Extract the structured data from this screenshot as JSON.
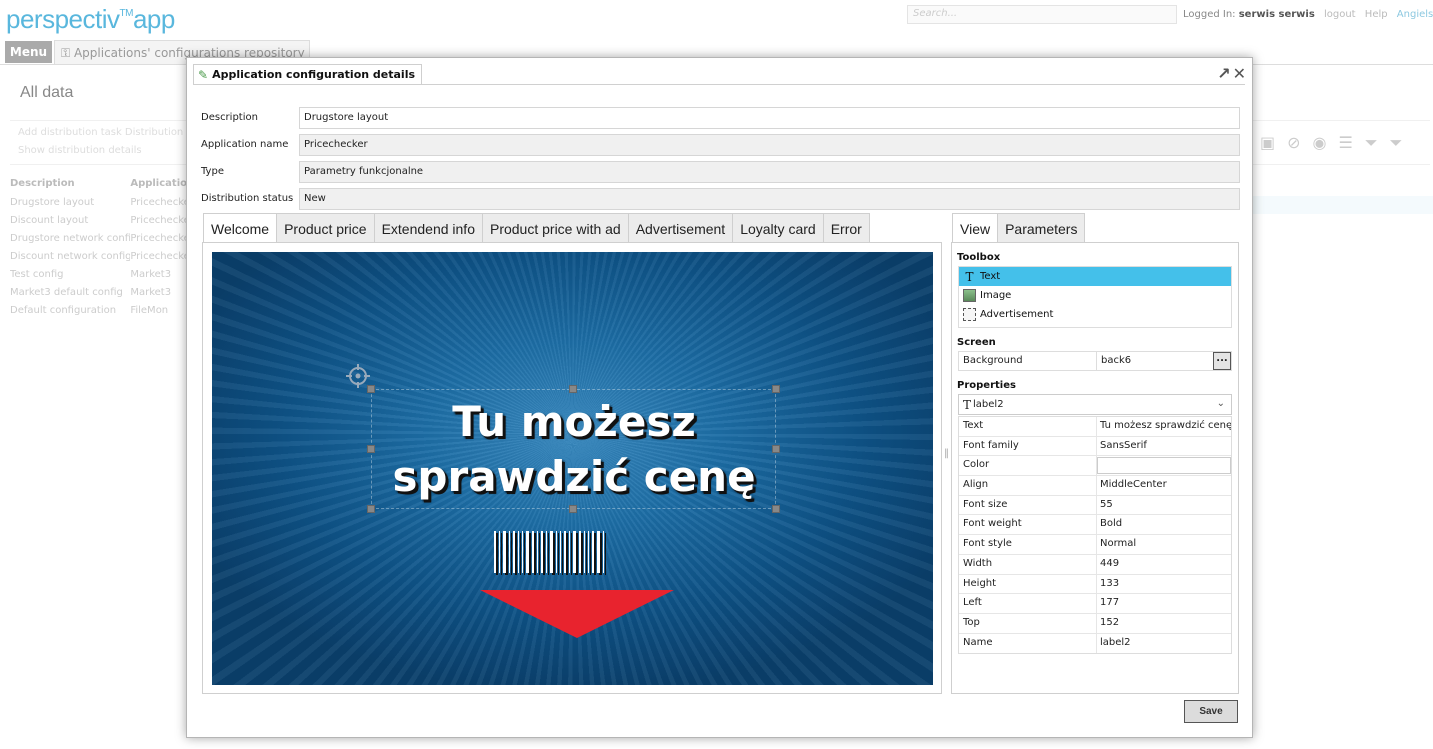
{
  "app": {
    "logo_main": "perspectiv",
    "logo_tm": "TM",
    "logo_suffix": "app",
    "search_placeholder": "Search...",
    "logged_in_label": "Logged In:",
    "user": "serwis serwis",
    "logout": "logout",
    "help": "Help",
    "language": "Angielski",
    "menu": "Menu",
    "app_tab": "Applications' configurations repository",
    "page_title": "All data",
    "toolbar_links": "Add distribution task   Distribution t...",
    "toolbar_link2": "Show distribution details",
    "grid_headers": [
      "Description",
      "Application"
    ],
    "grid_rows": [
      [
        "Drugstore layout",
        "Pricechecker"
      ],
      [
        "Discount layout",
        "Pricechecker"
      ],
      [
        "Drugstore network config",
        "Pricechecker"
      ],
      [
        "Discount network config",
        "Pricechecker"
      ],
      [
        "Test config",
        "Market3"
      ],
      [
        "Market3 default config",
        "Market3"
      ],
      [
        "Default configuration",
        "FileMon"
      ]
    ]
  },
  "dialog": {
    "title": "Application configuration details",
    "fields": [
      {
        "label": "Description",
        "value": "Drugstore layout",
        "readonly": false
      },
      {
        "label": "Application name",
        "value": "Pricechecker",
        "readonly": true
      },
      {
        "label": "Type",
        "value": "Parametry funkcjonalne",
        "readonly": true
      },
      {
        "label": "Distribution status",
        "value": "New",
        "readonly": true
      }
    ],
    "screen_tabs": [
      "Welcome",
      "Product price",
      "Extendend info",
      "Product price with ad",
      "Advertisement",
      "Loyalty card",
      "Error"
    ],
    "active_screen_tab": "Welcome",
    "canvas_text_line1": "Tu możesz",
    "canvas_text_line2": "sprawdzić cenę",
    "right_tabs": [
      "View",
      "Parameters"
    ],
    "active_right_tab": "View",
    "toolbox_title": "Toolbox",
    "toolbox_items": [
      {
        "label": "Text",
        "icon": "text-icon",
        "selected": true
      },
      {
        "label": "Image",
        "icon": "image-icon",
        "selected": false
      },
      {
        "label": "Advertisement",
        "icon": "advertisement-icon",
        "selected": false
      }
    ],
    "screen_title": "Screen",
    "background_label": "Background",
    "background_value": "back6",
    "browse_label": "...",
    "properties_title": "Properties",
    "selected_element": "label2",
    "properties": [
      {
        "key": "Text",
        "value": "Tu możesz sprawdzić cenę"
      },
      {
        "key": "Font family",
        "value": "SansSerif"
      },
      {
        "key": "Color",
        "value": ""
      },
      {
        "key": "Align",
        "value": "MiddleCenter"
      },
      {
        "key": "Font size",
        "value": "55"
      },
      {
        "key": "Font weight",
        "value": "Bold"
      },
      {
        "key": "Font style",
        "value": "Normal"
      },
      {
        "key": "Width",
        "value": "449"
      },
      {
        "key": "Height",
        "value": "133"
      },
      {
        "key": "Left",
        "value": "177"
      },
      {
        "key": "Top",
        "value": "152"
      },
      {
        "key": "Name",
        "value": "label2"
      }
    ],
    "save_label": "Save"
  },
  "colors": {
    "accent": "#59b7dd",
    "selection": "#44c0ea",
    "arrow": "#e8232e"
  }
}
